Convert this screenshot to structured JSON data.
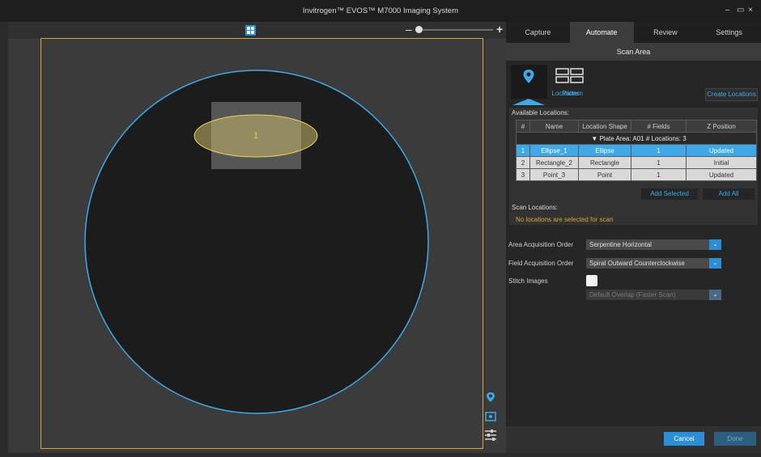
{
  "window": {
    "title": "Invitrogen™ EVOS™ M7000 Imaging System",
    "minimize": "‒",
    "restore": "▭",
    "close": "×"
  },
  "viewer": {
    "zoom_minus": "‒",
    "zoom_plus": "+",
    "zoom_level": 0.05,
    "location_label": "1"
  },
  "tabs": [
    {
      "label": "Capture"
    },
    {
      "label": "Automate"
    },
    {
      "label": "Review"
    },
    {
      "label": "Settings"
    }
  ],
  "scan_area": {
    "title": "Scan Area",
    "locations_btn": "Locations",
    "pattern_btn": "Pattern",
    "create_btn": "Create Locations",
    "available_label": "Available Locations:",
    "columns": [
      "#",
      "Name",
      "Location Shape",
      "# Fields",
      "Z Position"
    ],
    "plate_row": "Plate  Area: A01   # Locations: 3",
    "rows": [
      {
        "num": "1",
        "name": "Ellipse_1",
        "shape": "Ellipse",
        "fields": "1",
        "z": "Updated"
      },
      {
        "num": "2",
        "name": "Rectangle_2",
        "shape": "Rectangle",
        "fields": "1",
        "z": "Initial"
      },
      {
        "num": "3",
        "name": "Point_3",
        "shape": "Point",
        "fields": "1",
        "z": "Updated"
      }
    ],
    "add_selected": "Add Selected",
    "add_all": "Add All",
    "scan_locations_label": "Scan Locations:",
    "no_locations": "No locations are selected for scan"
  },
  "settings": {
    "area_order_label": "Area Acquisition Order",
    "area_order_value": "Serpentine Horizontal",
    "field_order_label": "Field Acquisition Order",
    "field_order_value": "Spiral Outward Counterclockwise",
    "stitch_label": "Stitch Images",
    "overlap_value": "Default Overlap (Faster Scan)"
  },
  "footer": {
    "cancel": "Cancel",
    "done": "Done"
  },
  "colors": {
    "accent": "#3fa8e8",
    "frame": "#d8a33a",
    "well": "#1c1c1c"
  }
}
